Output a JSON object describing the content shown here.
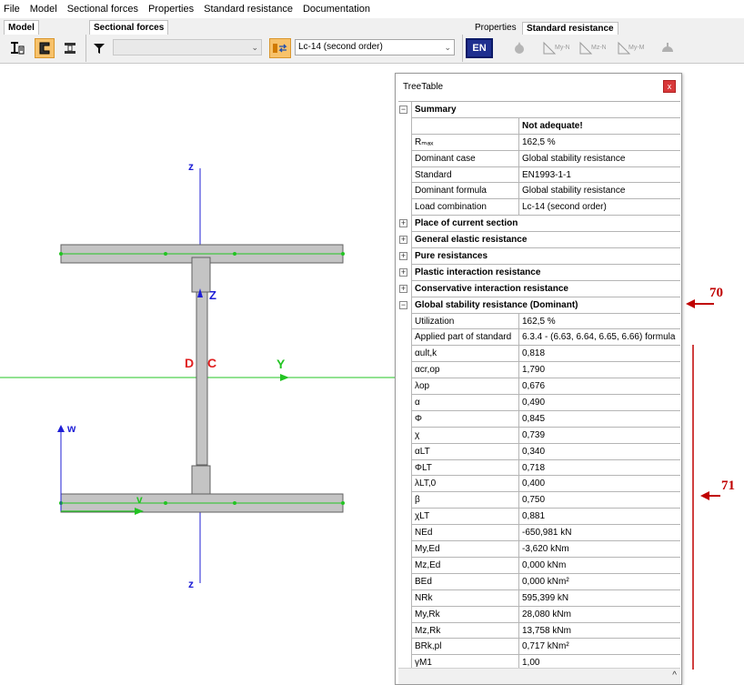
{
  "menu": [
    "File",
    "Model",
    "Sectional forces",
    "Properties",
    "Standard resistance",
    "Documentation"
  ],
  "toolbar": {
    "model_label": "Model",
    "sectional_forces_label": "Sectional forces",
    "properties_tab": "Properties",
    "standard_resistance_tab": "Standard resistance",
    "load_combination_value": "Lc-14 (second order)",
    "filter_combo_value": "",
    "standard_badge": "EN",
    "icons": [
      "section-icon",
      "cross-section-c-icon",
      "cross-section-i-icon",
      "filter-icon",
      "swap-icon",
      "en-flag-icon",
      "resistance-icon",
      "interaction-my-n-icon",
      "interaction-mz-n-icon",
      "interaction-my-mz-icon",
      "stability-icon"
    ]
  },
  "canvas": {
    "axis_labels": {
      "z_top": "z",
      "z_bottom": "z",
      "z_center": "Z",
      "y_right": "Y",
      "d_label": "D",
      "c_label": "C",
      "w_label": "w",
      "v_label": "v"
    },
    "colors": {
      "axis_blue": "#1f1fd6",
      "axis_green": "#23c423",
      "label_red": "#e02020",
      "section_fill": "#c4c4c4",
      "section_stroke": "#606060"
    }
  },
  "treetable": {
    "title": "TreeTable",
    "close_label": "x",
    "summary": {
      "label": "Summary",
      "expander": "−",
      "rows": [
        {
          "key": "",
          "value": "Not adequate!"
        },
        {
          "key": "Rₘₐₓ",
          "value": "162,5 %"
        },
        {
          "key": "Dominant case",
          "value": "Global stability resistance"
        },
        {
          "key": "Standard",
          "value": "EN1993-1-1"
        },
        {
          "key": "Dominant formula",
          "value": "Global stability resistance"
        },
        {
          "key": "Load combination",
          "value": "Lc-14 (second order)"
        }
      ]
    },
    "collapsed_sections": [
      {
        "label": "Place of current section",
        "expander": "+"
      },
      {
        "label": "General elastic resistance",
        "expander": "+"
      },
      {
        "label": "Pure resistances",
        "expander": "+"
      },
      {
        "label": "Plastic interaction resistance",
        "expander": "+"
      },
      {
        "label": "Conservative interaction resistance",
        "expander": "+"
      }
    ],
    "global_stability": {
      "label": "Global stability resistance (Dominant)",
      "expander": "−",
      "rows": [
        {
          "key": "Utilization",
          "value": "162,5 %"
        },
        {
          "key": "Applied part of standard",
          "value": "6.3.4 - (6.63, 6.64, 6.65, 6.66) formula"
        },
        {
          "key": "αult,k",
          "value": "0,818"
        },
        {
          "key": "αcr,op",
          "value": "1,790"
        },
        {
          "key": "λop",
          "value": "0,676"
        },
        {
          "key": "α",
          "value": "0,490"
        },
        {
          "key": "Φ",
          "value": "0,845"
        },
        {
          "key": "χ",
          "value": "0,739"
        },
        {
          "key": "αLT",
          "value": "0,340"
        },
        {
          "key": "ΦLT",
          "value": "0,718"
        },
        {
          "key": "λLT,0",
          "value": "0,400"
        },
        {
          "key": "β",
          "value": "0,750"
        },
        {
          "key": "χLT",
          "value": "0,881"
        },
        {
          "key": "NEd",
          "value": "-650,981 kN"
        },
        {
          "key": "My,Ed",
          "value": "-3,620 kNm"
        },
        {
          "key": "Mz,Ed",
          "value": "0,000 kNm"
        },
        {
          "key": "BEd",
          "value": "0,000 kNm²"
        },
        {
          "key": "NRk",
          "value": "595,399 kN"
        },
        {
          "key": "My,Rk",
          "value": "28,080 kNm"
        },
        {
          "key": "Mz,Rk",
          "value": "13,758 kNm"
        },
        {
          "key": "BRk,pl",
          "value": "0,717 kNm²"
        },
        {
          "key": "γM1",
          "value": "1,00"
        }
      ]
    },
    "scroll_up": "^"
  },
  "annotations": {
    "label_70": "70",
    "label_71": "71",
    "color": "#c00000"
  }
}
